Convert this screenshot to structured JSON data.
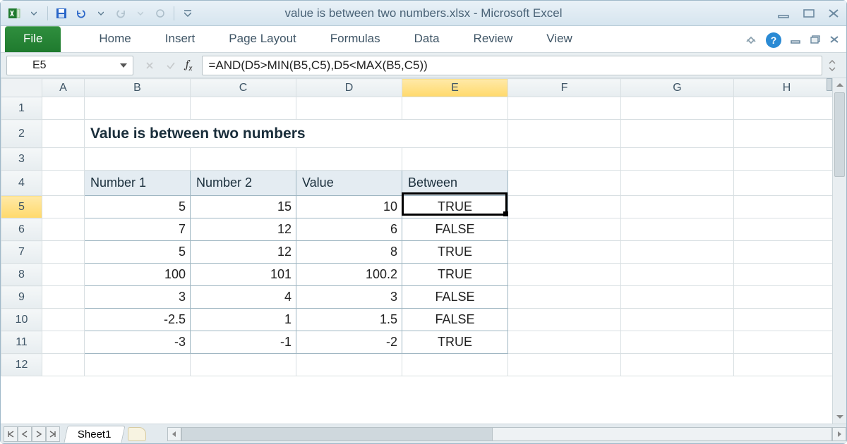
{
  "title": "value is between two numbers.xlsx  -  Microsoft Excel",
  "ribbon": {
    "file": "File",
    "tabs": [
      "Home",
      "Insert",
      "Page Layout",
      "Formulas",
      "Data",
      "Review",
      "View"
    ]
  },
  "name_box": "E5",
  "formula": "=AND(D5>MIN(B5,C5),D5<MAX(B5,C5))",
  "columns": [
    "A",
    "B",
    "C",
    "D",
    "E",
    "F",
    "G",
    "H"
  ],
  "rows": [
    "1",
    "2",
    "3",
    "4",
    "5",
    "6",
    "7",
    "8",
    "9",
    "10",
    "11",
    "12"
  ],
  "selected_col": "E",
  "selected_row": "5",
  "sheet": {
    "title_text": "Value is between two numbers",
    "headers": {
      "b": "Number 1",
      "c": "Number 2",
      "d": "Value",
      "e": "Between"
    },
    "data": [
      {
        "b": "5",
        "c": "15",
        "d": "10",
        "e": "TRUE"
      },
      {
        "b": "7",
        "c": "12",
        "d": "6",
        "e": "FALSE"
      },
      {
        "b": "5",
        "c": "12",
        "d": "8",
        "e": "TRUE"
      },
      {
        "b": "100",
        "c": "101",
        "d": "100.2",
        "e": "TRUE"
      },
      {
        "b": "3",
        "c": "4",
        "d": "3",
        "e": "FALSE"
      },
      {
        "b": "-2.5",
        "c": "1",
        "d": "1.5",
        "e": "FALSE"
      },
      {
        "b": "-3",
        "c": "-1",
        "d": "-2",
        "e": "TRUE"
      }
    ]
  },
  "sheet_tab": "Sheet1"
}
